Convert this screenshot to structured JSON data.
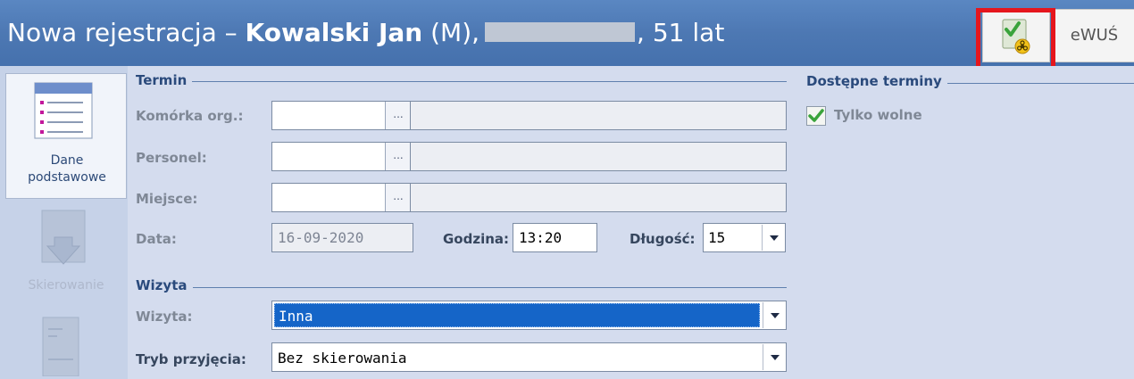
{
  "title": {
    "prefix": "Nowa rejestracja – ",
    "patient_name": "Kowalski Jan",
    "sex": " (M),",
    "age": ", 51 lat"
  },
  "toolbar": {
    "ewus_label": "eWUŚ",
    "covid_icon": "clipboard-check-biohazard-icon"
  },
  "sidebar": {
    "items": [
      {
        "label_line1": "Dane",
        "label_line2": "podstawowe",
        "icon": "list-form-icon",
        "state": "selected"
      },
      {
        "label": "Skierowanie",
        "icon": "document-arrow-icon",
        "state": "disabled"
      },
      {
        "label": "",
        "icon": "document-stamp-icon",
        "state": "disabled"
      }
    ]
  },
  "termin": {
    "section_title": "Termin",
    "komorka_label": "Komórka org.:",
    "komorka_value": "",
    "personel_label": "Personel:",
    "personel_value": "",
    "miejsce_label": "Miejsce:",
    "miejsce_value": "",
    "browse_button": "...",
    "data_label": "Data:",
    "data_value": "16-09-2020",
    "godzina_label": "Godzina:",
    "godzina_value": "13:20",
    "dlugosc_label": "Długość:",
    "dlugosc_value": "15"
  },
  "wizyta": {
    "section_title": "Wizyta",
    "wizyta_label": "Wizyta:",
    "wizyta_value": "Inna",
    "tryb_label": "Tryb przyjęcia:",
    "tryb_value": "Bez skierowania"
  },
  "dostepne": {
    "section_title": "Dostępne terminy",
    "tylko_wolne_label": "Tylko wolne",
    "tylko_wolne_checked": true
  },
  "colors": {
    "title_bar": "#4d78b3",
    "highlight": "#e5161d",
    "selection": "#1565c8",
    "check_green": "#3aa33b"
  }
}
